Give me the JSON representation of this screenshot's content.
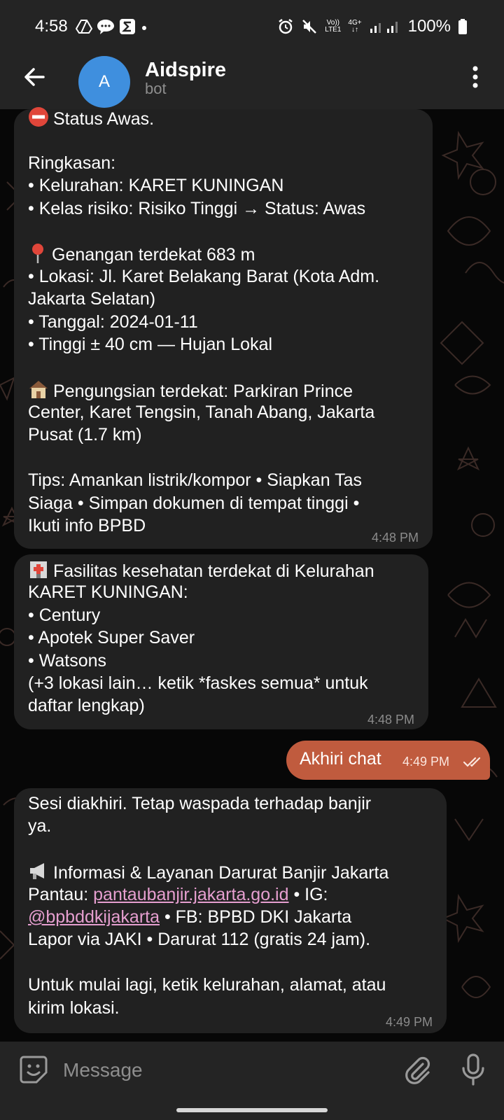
{
  "status_bar": {
    "time": "4:58",
    "battery": "100%",
    "net_top": "Vo))",
    "net_bottom": "LTE1",
    "net2_top": "4G+",
    "net2_bottom": "↓↑",
    "icons": [
      "drive-icon",
      "chat-bubble-icon",
      "sigma-icon",
      "dot-icon",
      "alarm-icon",
      "mute-icon",
      "signal-icon",
      "battery-icon"
    ]
  },
  "header": {
    "avatar_letter": "A",
    "title": "Aidspire",
    "subtitle": "bot",
    "avatar_color": "#3f8fde"
  },
  "messages": [
    {
      "id": "msg-status",
      "lines": [
        "Status Awas.",
        "",
        "Ringkasan:",
        "• Kelurahan: KARET KUNINGAN",
        "• Kelas risiko: Risiko Tinggi → Status: Awas",
        "",
        "Genangan terdekat 683 m",
        "• Lokasi: Jl. Karet Belakang Barat (Kota Adm.",
        "Jakarta Selatan)",
        "• Tanggal: 2024-01-11",
        "• Tinggi ± 40 cm — Hujan Lokal",
        "",
        "Pengungsian terdekat: Parkiran Prince",
        "Center, Karet Tengsin, Tanah Abang, Jakarta",
        "Pusat (1.7 km)",
        "",
        "Tips: Amankan listrik/kompor • Siapkan Tas",
        "Siaga • Simpan dokumen di tempat tinggi •",
        "Ikuti info BPBD"
      ],
      "time": "4:48 PM"
    },
    {
      "id": "msg-faskes",
      "lines": [
        "Fasilitas kesehatan terdekat di Kelurahan",
        "KARET KUNINGAN:",
        "• Century",
        "• Apotek Super Saver",
        "• Watsons",
        "(+3 lokasi lain… ketik *faskes semua* untuk",
        "daftar lengkap)"
      ],
      "time": "4:48 PM"
    },
    {
      "id": "msg-out",
      "text": "Akhiri chat",
      "time": "4:49 PM"
    },
    {
      "id": "msg-end",
      "lines": [
        "Sesi diakhiri. Tetap waspada terhadap banjir",
        "ya.",
        "",
        "Informasi & Layanan Darurat Banjir Jakarta",
        "",
        "",
        "Lapor via JAKI • Darurat 112 (gratis 24 jam).",
        "",
        "Untuk mulai lagi, ketik kelurahan, alamat, atau",
        "kirim lokasi."
      ],
      "pantau_prefix": "Pantau: ",
      "pantau_link": "pantaubanjir.jakarta.go.id",
      "ig_prefix": " • IG:",
      "ig_link": "@bpbddkijakarta",
      "fb_text": " • FB: BPBD DKI Jakarta",
      "time": "4:49 PM"
    }
  ],
  "input": {
    "placeholder": "Message"
  },
  "colors": {
    "bubble_in": "#212121",
    "bubble_out": "#c05b3e",
    "link": "#e69fd0",
    "header_bg": "#242424"
  }
}
